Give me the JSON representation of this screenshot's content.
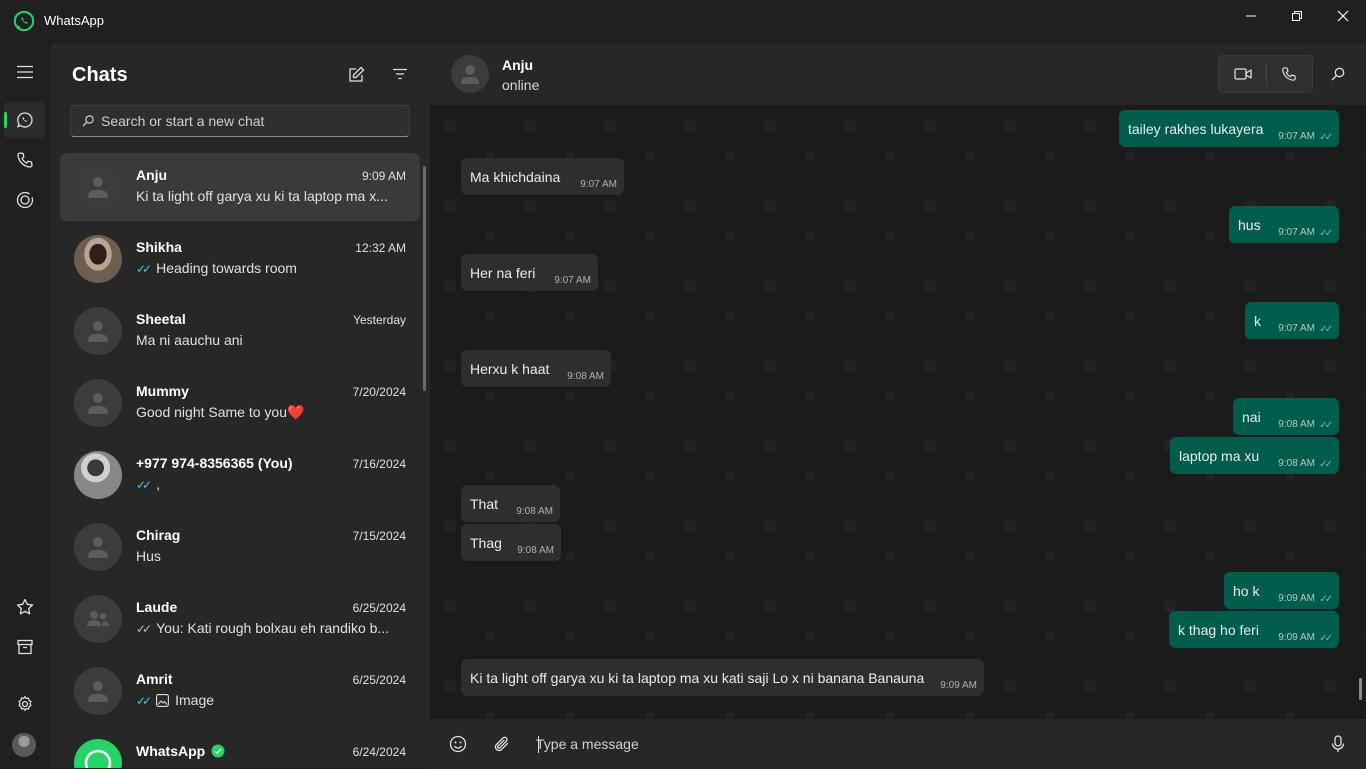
{
  "window": {
    "app_title": "WhatsApp",
    "icons": {
      "app": "whatsapp-logo-icon",
      "minimize": "minimize-icon",
      "maximize": "restore-icon",
      "close": "close-icon"
    }
  },
  "rail": {
    "items": [
      "menu-icon",
      "chats-icon",
      "calls-icon",
      "status-icon",
      "starred-icon",
      "archive-icon",
      "settings-icon"
    ],
    "active": "chats"
  },
  "chatlist": {
    "title": "Chats",
    "search_placeholder": "Search or start a new chat",
    "items": [
      {
        "name": "Anju",
        "time": "9:09 AM",
        "preview": "Ki ta light off garya xu ki ta laptop ma x...",
        "ticks": "none",
        "selected": true
      },
      {
        "name": "Shikha",
        "time": "12:32 AM",
        "preview": "Heading  towards room",
        "ticks": "blue"
      },
      {
        "name": "Sheetal",
        "time": "Yesterday",
        "preview": "Ma ni aauchu ani",
        "ticks": "none"
      },
      {
        "name": "Mummy",
        "time": "7/20/2024",
        "preview": "Good night Same to you❤️",
        "ticks": "none"
      },
      {
        "name": "+977 974-8356365 (You)",
        "time": "7/16/2024",
        "preview": ",",
        "ticks": "blue"
      },
      {
        "name": "Chirag",
        "time": "7/15/2024",
        "preview": "Hus",
        "ticks": "none"
      },
      {
        "name": "Laude",
        "time": "6/25/2024",
        "preview": "You: Kati rough bolxau eh randiko b...",
        "ticks": "grey"
      },
      {
        "name": "Amrit",
        "time": "6/25/2024",
        "preview": "Image",
        "ticks": "blue"
      },
      {
        "name": "WhatsApp",
        "time": "6/24/2024",
        "preview": "",
        "ticks": "none"
      }
    ]
  },
  "conversation": {
    "contact_name": "Anju",
    "contact_status": "online",
    "composer_placeholder": "Type a message",
    "messages": [
      {
        "dir": "out",
        "text": "tailey rakhes lukayera",
        "time": "9:07 AM"
      },
      {
        "dir": "in",
        "text": "Ma khichdaina",
        "time": "9:07 AM"
      },
      {
        "dir": "out",
        "text": "hus",
        "time": "9:07 AM"
      },
      {
        "dir": "in",
        "text": "Her na feri",
        "time": "9:07 AM"
      },
      {
        "dir": "out",
        "text": "k",
        "time": "9:07 AM"
      },
      {
        "dir": "in",
        "text": "Herxu k haat",
        "time": "9:08 AM"
      },
      {
        "dir": "out",
        "text": "nai",
        "time": "9:08 AM"
      },
      {
        "dir": "out",
        "text": "laptop ma xu",
        "time": "9:08 AM"
      },
      {
        "dir": "in",
        "text": "That",
        "time": "9:08 AM"
      },
      {
        "dir": "in",
        "text": "Thag",
        "time": "9:08 AM"
      },
      {
        "dir": "out",
        "text": "ho k",
        "time": "9:09 AM"
      },
      {
        "dir": "out",
        "text": "k thag ho feri",
        "time": "9:09 AM"
      },
      {
        "dir": "in",
        "text": "Ki ta light off garya xu ki ta laptop ma xu kati saji Lo x ni banana Banauna",
        "time": "9:09 AM"
      }
    ]
  },
  "colors": {
    "accent": "#25d366",
    "outgoing_bubble": "#005c4b",
    "read_ticks": "#53bdeb"
  }
}
